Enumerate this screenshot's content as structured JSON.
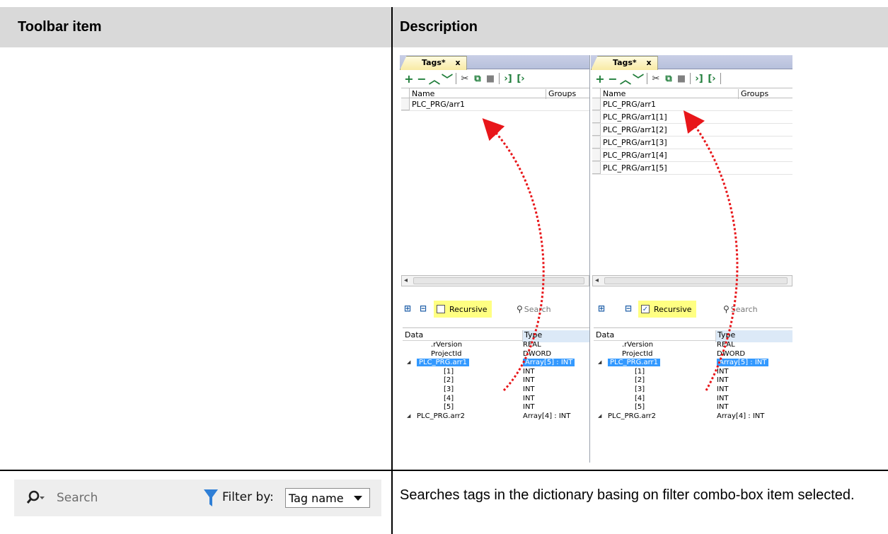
{
  "table": {
    "header_left": "Toolbar item",
    "header_right": "Description"
  },
  "panel_left": {
    "tab_label": "Tags*",
    "tab_close": "x",
    "col_name": "Name",
    "col_groups": "Groups",
    "rows": [
      "PLC_PRG/arr1"
    ],
    "recursive_label": "Recursive",
    "recursive_checked": false,
    "search_placeholder": "Search",
    "tree_col_data": "Data",
    "tree_col_type": "Type"
  },
  "panel_right": {
    "tab_label": "Tags*",
    "tab_close": "x",
    "col_name": "Name",
    "col_groups": "Groups",
    "rows": [
      "PLC_PRG/arr1",
      "PLC_PRG/arr1[1]",
      "PLC_PRG/arr1[2]",
      "PLC_PRG/arr1[3]",
      "PLC_PRG/arr1[4]",
      "PLC_PRG/arr1[5]"
    ],
    "recursive_label": "Recursive",
    "recursive_checked": true,
    "search_placeholder": "Search",
    "tree_col_data": "Data",
    "tree_col_type": "Type"
  },
  "tree_rows": [
    {
      "name": ".rVersion",
      "type": "REAL",
      "selected": false
    },
    {
      "name": "ProjectId",
      "type": "DWORD",
      "selected": false
    },
    {
      "name": "PLC_PRG.arr1",
      "type": "Array[5] : INT",
      "selected": true
    },
    {
      "name": "[1]",
      "type": "INT",
      "selected": false
    },
    {
      "name": "[2]",
      "type": "INT",
      "selected": false
    },
    {
      "name": "[3]",
      "type": "INT",
      "selected": false
    },
    {
      "name": "[4]",
      "type": "INT",
      "selected": false
    },
    {
      "name": "[5]",
      "type": "INT",
      "selected": false
    },
    {
      "name": "PLC_PRG.arr2",
      "type": "Array[4] : INT",
      "selected": false
    }
  ],
  "search_widget": {
    "placeholder": "Search",
    "filter_label": "Filter by:",
    "filter_value": "Tag name"
  },
  "description": "Searches tags in the dictionary basing on filter combo-box item selected.",
  "colors": {
    "header_bg": "#d9d9d9",
    "highlight": "#ffff82",
    "selection": "#3399ff",
    "arrow": "#e8161a",
    "toolbar_green": "#1f7d3a",
    "funnel": "#2f7fd6"
  }
}
